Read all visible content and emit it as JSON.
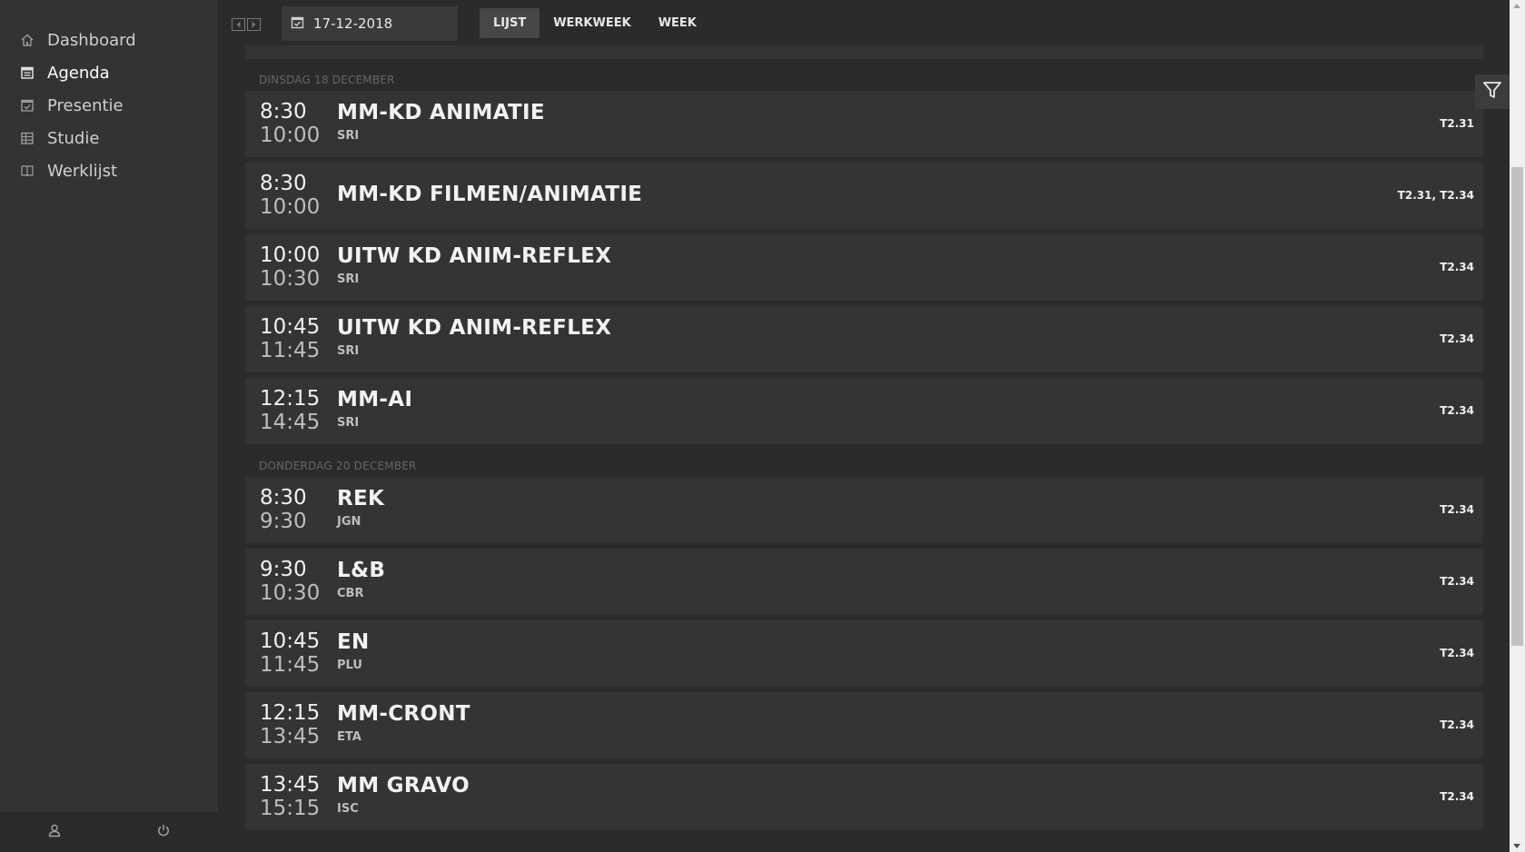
{
  "sidebar": {
    "items": [
      {
        "label": "Dashboard",
        "icon": "home-icon"
      },
      {
        "label": "Agenda",
        "icon": "calendar-icon",
        "active": true
      },
      {
        "label": "Presentie",
        "icon": "checkbox-icon"
      },
      {
        "label": "Studie",
        "icon": "grid-icon"
      },
      {
        "label": "Werklijst",
        "icon": "book-icon"
      }
    ],
    "footer": {
      "user_icon": "user-icon",
      "power_icon": "power-icon"
    }
  },
  "toolbar": {
    "date_value": "17-12-2018",
    "tabs": [
      {
        "label": "LIJST",
        "active": true
      },
      {
        "label": "WERKWEEK"
      },
      {
        "label": "WEEK"
      }
    ]
  },
  "days": [
    {
      "header": "DINSDAG 18 DECEMBER",
      "events": [
        {
          "start": "8:30",
          "end": "10:00",
          "title": "MM-KD ANIMATIE",
          "teacher": "SRI",
          "room": "T2.31"
        },
        {
          "start": "8:30",
          "end": "10:00",
          "title": "MM-KD FILMEN/ANIMATIE",
          "teacher": "",
          "room": "T2.31, T2.34"
        },
        {
          "start": "10:00",
          "end": "10:30",
          "title": "UITW KD ANIM-REFLEX",
          "teacher": "SRI",
          "room": "T2.34"
        },
        {
          "start": "10:45",
          "end": "11:45",
          "title": "UITW KD ANIM-REFLEX",
          "teacher": "SRI",
          "room": "T2.34"
        },
        {
          "start": "12:15",
          "end": "14:45",
          "title": "MM-AI",
          "teacher": "SRI",
          "room": "T2.34"
        }
      ]
    },
    {
      "header": "DONDERDAG 20 DECEMBER",
      "events": [
        {
          "start": "8:30",
          "end": "9:30",
          "title": "REK",
          "teacher": "JGN",
          "room": "T2.34"
        },
        {
          "start": "9:30",
          "end": "10:30",
          "title": "L&B",
          "teacher": "CBR",
          "room": "T2.34"
        },
        {
          "start": "10:45",
          "end": "11:45",
          "title": "EN",
          "teacher": "PLU",
          "room": "T2.34"
        },
        {
          "start": "12:15",
          "end": "13:45",
          "title": "MM-CRONT",
          "teacher": "ETA",
          "room": "T2.34"
        },
        {
          "start": "13:45",
          "end": "15:15",
          "title": "MM GRAVO",
          "teacher": "ISC",
          "room": "T2.34"
        }
      ]
    }
  ],
  "colors": {
    "bg": "#2b2b2b",
    "sidebar": "#333333",
    "card": "#343434",
    "active_tab": "#474747"
  }
}
